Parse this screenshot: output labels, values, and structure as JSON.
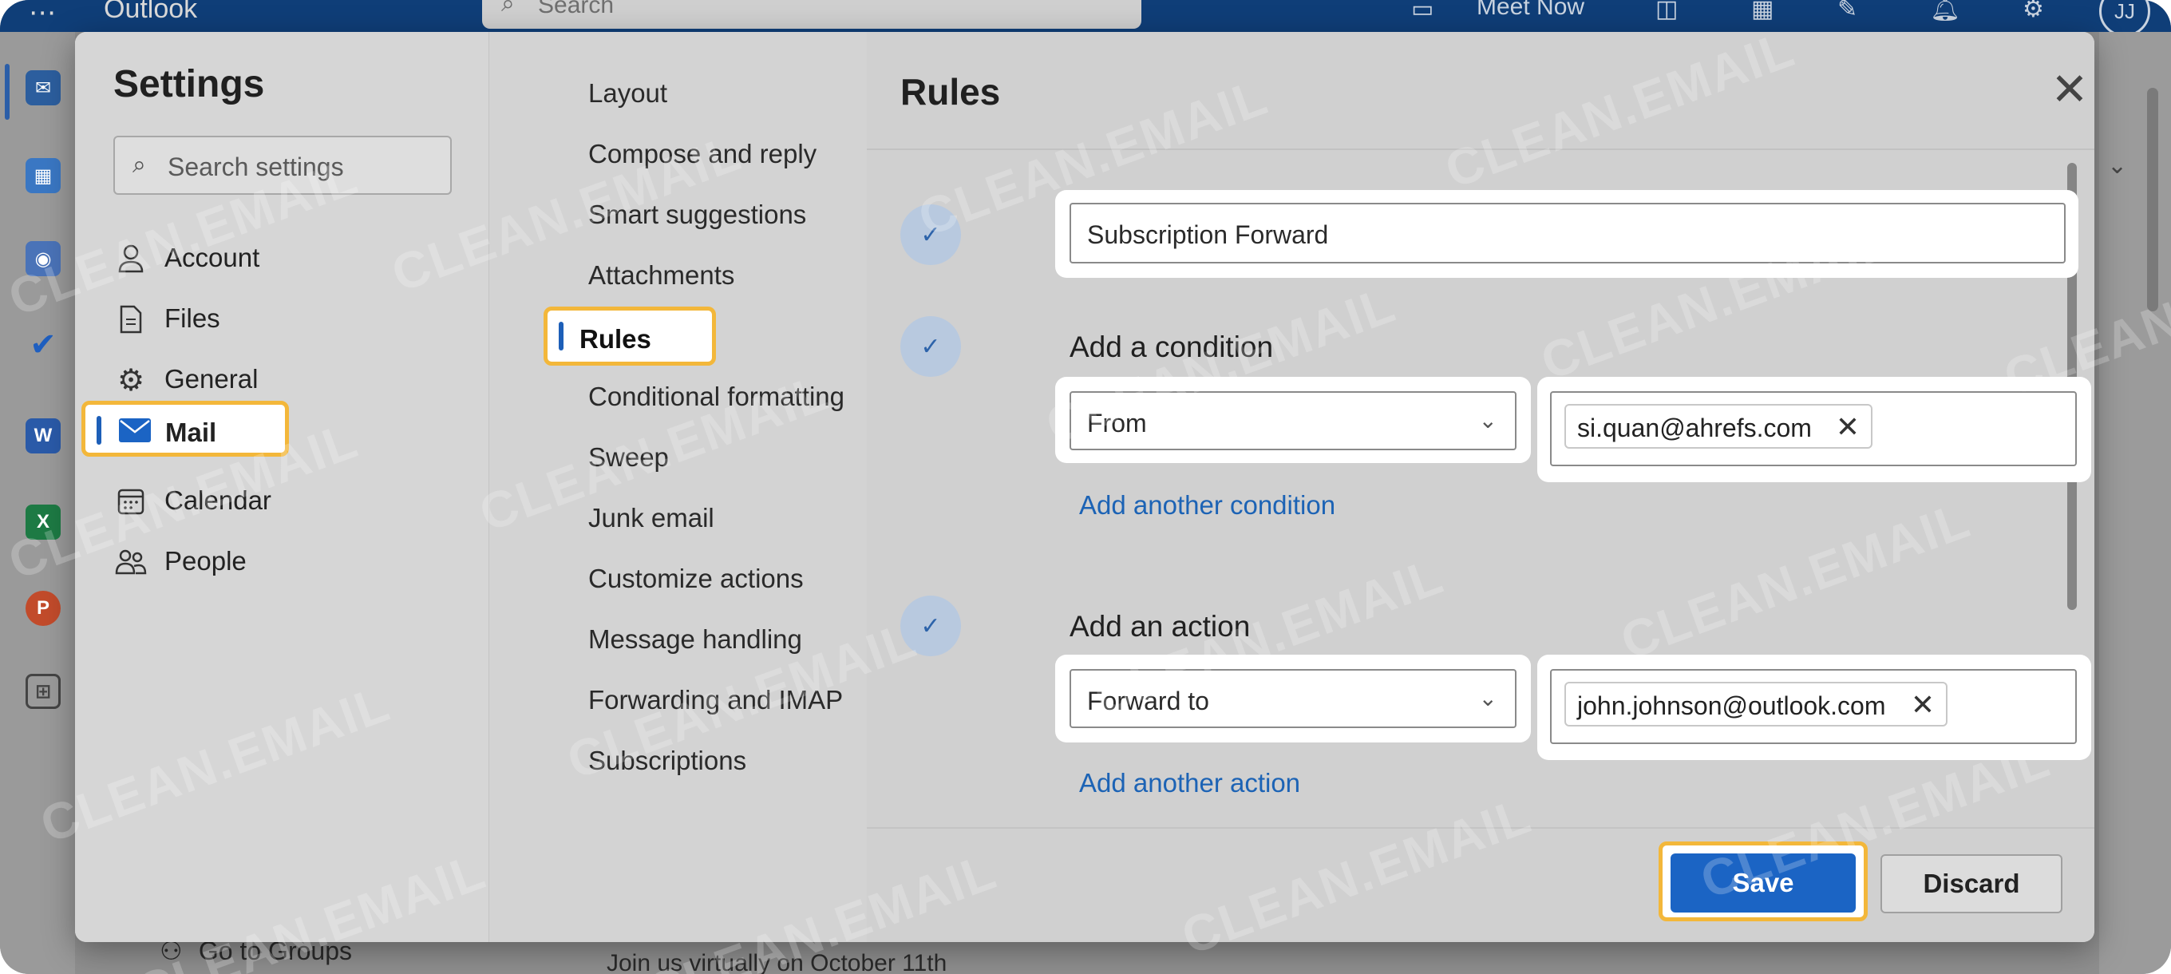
{
  "background": {
    "app_title": "Outlook",
    "search_placeholder": "Search",
    "meet_now": "Meet Now",
    "avatar_initials": "JJ",
    "go_to_groups": "Go to Groups",
    "message_preview": "Join us virtually on October 11th"
  },
  "settings": {
    "title": "Settings",
    "search_placeholder": "Search settings",
    "nav": [
      {
        "label": "Account",
        "icon": "person-icon"
      },
      {
        "label": "Files",
        "icon": "document-icon"
      },
      {
        "label": "General",
        "icon": "gear-icon"
      },
      {
        "label": "Mail",
        "icon": "mail-icon"
      },
      {
        "label": "Calendar",
        "icon": "calendar-icon"
      },
      {
        "label": "People",
        "icon": "people-icon"
      }
    ],
    "mail_menu": [
      "Layout",
      "Compose and reply",
      "Smart suggestions",
      "Attachments",
      "Rules",
      "Conditional formatting",
      "Sweep",
      "Junk email",
      "Customize actions",
      "Message handling",
      "Forwarding and IMAP",
      "Subscriptions"
    ]
  },
  "rules": {
    "title": "Rules",
    "rule_name": "Subscription Forward",
    "condition": {
      "heading": "Add a condition",
      "type": "From",
      "value_chip": "si.quan@ahrefs.com",
      "add_link": "Add another condition"
    },
    "action": {
      "heading": "Add an action",
      "type": "Forward to",
      "value_chip": "john.johnson@outlook.com",
      "add_link": "Add another action"
    },
    "save_label": "Save",
    "discard_label": "Discard"
  },
  "watermark": "CLEAN.EMAIL",
  "colors": {
    "accent": "#1b64c4",
    "highlight": "#f3b73a",
    "link": "#1c63b5"
  }
}
